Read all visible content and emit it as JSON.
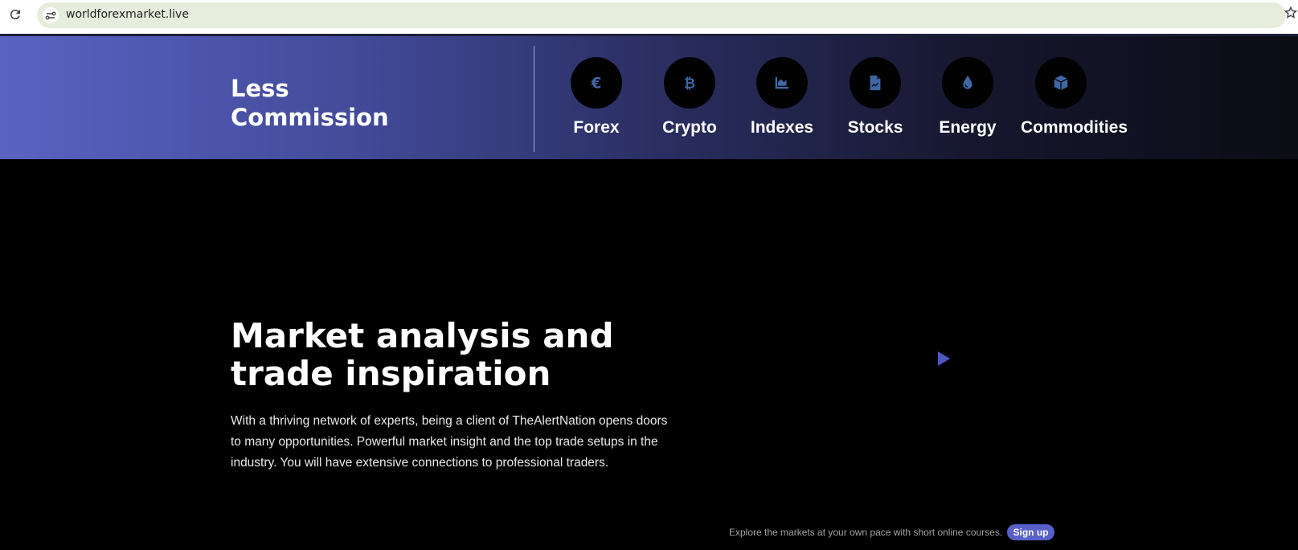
{
  "browser": {
    "url": "worldforexmarket.live"
  },
  "header": {
    "title": "Less Commission",
    "markets": [
      {
        "label": "Forex",
        "icon": "euro-icon"
      },
      {
        "label": "Crypto",
        "icon": "bitcoin-icon"
      },
      {
        "label": "Indexes",
        "icon": "area-chart-icon"
      },
      {
        "label": "Stocks",
        "icon": "document-chart-icon"
      },
      {
        "label": "Energy",
        "icon": "drop-icon"
      },
      {
        "label": "Commodities",
        "icon": "cube-icon"
      }
    ]
  },
  "hero": {
    "title": "Market analysis and trade inspiration",
    "text": "With a thriving network of experts, being a client of TheAlertNation opens doors to many opportunities. Powerful market insight and the top trade setups in the industry. You will have extensive connections to professional traders."
  },
  "footer": {
    "note": "Explore the markets at your own pace with short online courses.",
    "signup_label": "Sign up"
  },
  "colors": {
    "accent": "#5860c9",
    "icon": "#3f67a5",
    "band_start": "#5a63c3",
    "band_end": "#0b0c14"
  }
}
